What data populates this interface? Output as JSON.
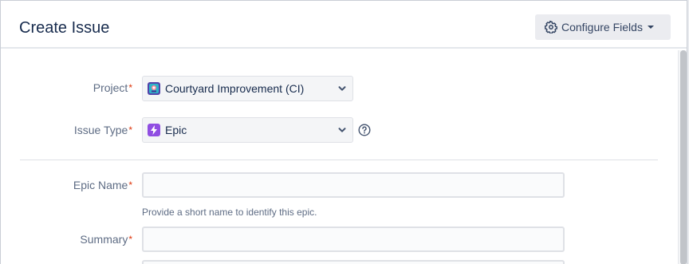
{
  "dialog": {
    "title": "Create Issue",
    "configure_fields_label": "Configure Fields"
  },
  "form": {
    "project": {
      "label": "Project",
      "required_marker": "*",
      "value": "Courtyard Improvement (CI)"
    },
    "issue_type": {
      "label": "Issue Type",
      "required_marker": "*",
      "value": "Epic"
    },
    "epic_name": {
      "label": "Epic Name",
      "required_marker": "*",
      "value": "",
      "hint": "Provide a short name to identify this epic."
    },
    "summary": {
      "label": "Summary",
      "required_marker": "*",
      "value": ""
    }
  },
  "icons": {
    "configure": "gear-icon",
    "configure_caret": "caret-down-icon",
    "project": "project-avatar-icon",
    "issue_type": "epic-lightning-icon",
    "help": "question-circle-icon",
    "dropdown": "chevron-down-icon"
  },
  "colors": {
    "required": "#de350b",
    "epic": "#904ee2",
    "project_avatar": "#5243aa",
    "button_bg": "#ebecf0",
    "label_text": "#5e6c84"
  }
}
